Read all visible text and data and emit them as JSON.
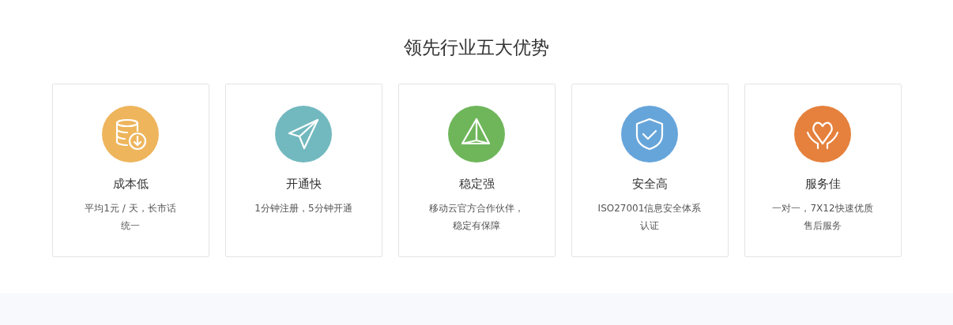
{
  "title": "领先行业五大优势",
  "cards": [
    {
      "kind": "database",
      "color": "#eeb55c",
      "heading": "成本低",
      "lines": [
        "平均1元 / 天，长市话",
        "统一"
      ]
    },
    {
      "kind": "send",
      "color": "#72b9bf",
      "heading": "开通快",
      "lines": [
        "1分钟注册，5分钟开通"
      ]
    },
    {
      "kind": "pyramid",
      "color": "#6fb65b",
      "heading": "稳定强",
      "lines": [
        "移动云官方合作伙伴，",
        "稳定有保障"
      ]
    },
    {
      "kind": "shield",
      "color": "#66a5da",
      "heading": "安全高",
      "lines": [
        "ISO27001信息安全体系",
        "认证"
      ]
    },
    {
      "kind": "heart",
      "color": "#e5813d",
      "heading": "服务佳",
      "lines": [
        "一对一，7X12快速优质",
        "售后服务"
      ]
    }
  ]
}
